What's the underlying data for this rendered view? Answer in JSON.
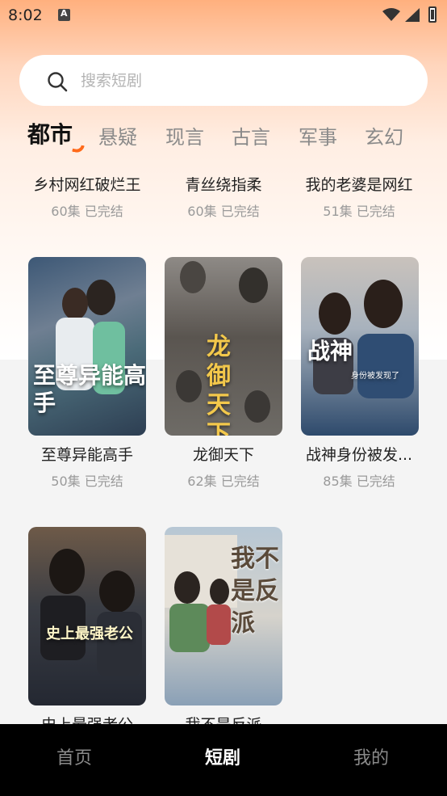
{
  "status": {
    "time": "8:02"
  },
  "search": {
    "placeholder": "搜索短剧"
  },
  "tabs": [
    "都市",
    "悬疑",
    "现言",
    "古言",
    "军事",
    "玄幻"
  ],
  "row0": [
    {
      "title": "乡村网红破烂王",
      "meta": "60集 已完结"
    },
    {
      "title": "青丝绕指柔",
      "meta": "60集 已完结"
    },
    {
      "title": "我的老婆是网红",
      "meta": "51集 已完结"
    }
  ],
  "row1": [
    {
      "title": "至尊异能高手",
      "meta": "50集 已完结",
      "cover_text": "至尊异能高手"
    },
    {
      "title": "龙御天下",
      "meta": "62集 已完结",
      "cover_text": "龙御天下"
    },
    {
      "title": "战神身份被发...",
      "meta": "85集 已完结",
      "cover_text": "战神",
      "cover_sub": "身份被发现了"
    }
  ],
  "row2": [
    {
      "title": "史上最强老公",
      "cover_text": "史上最强老公"
    },
    {
      "title": "我不是反派",
      "cover_text": "我不是反派"
    }
  ],
  "nav": [
    "首页",
    "短剧",
    "我的"
  ],
  "colors": {
    "accent": "#ff6a1a",
    "nav_bg": "#000000"
  }
}
